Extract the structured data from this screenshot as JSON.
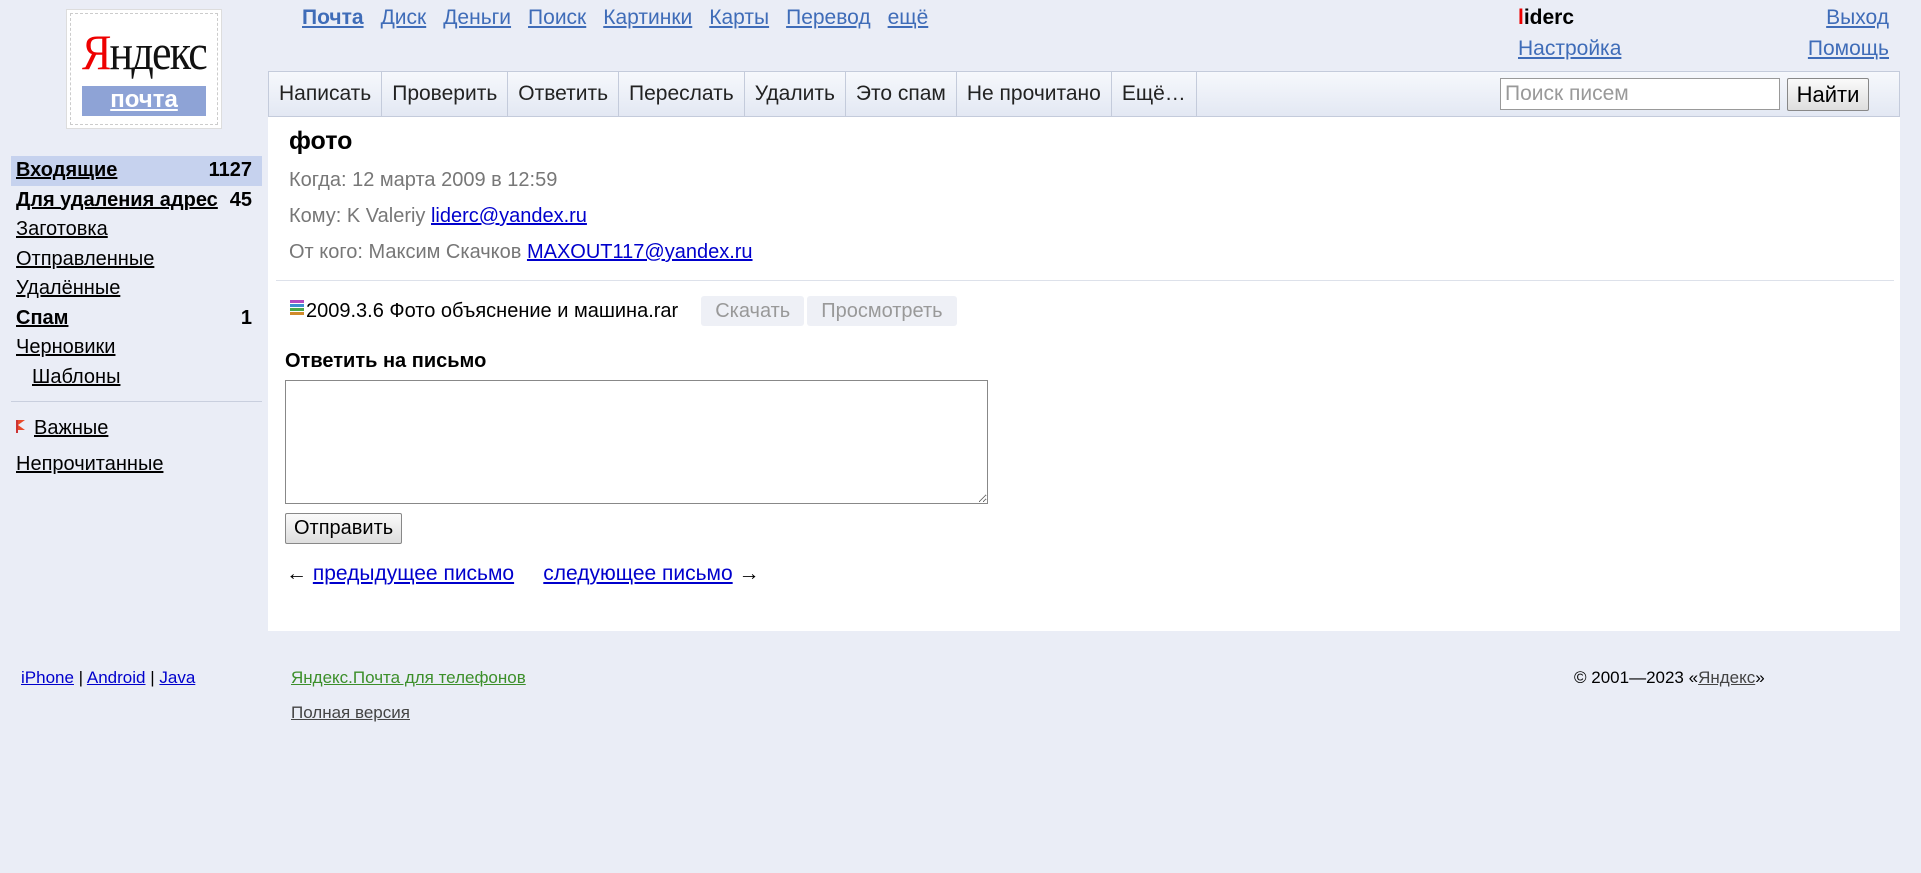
{
  "logo": {
    "word_first": "Я",
    "word_rest": "ндекс",
    "sub": "почта"
  },
  "topnav": [
    "Почта",
    "Диск",
    "Деньги",
    "Поиск",
    "Картинки",
    "Карты",
    "Перевод",
    "ещё"
  ],
  "user": {
    "first": "l",
    "rest": "iderc",
    "settings": "Настройка",
    "logout": "Выход",
    "help": "Помощь"
  },
  "toolbar": {
    "buttons": [
      "Написать",
      "Проверить",
      "Ответить",
      "Переслать",
      "Удалить",
      "Это спам",
      "Не прочитано",
      "Ещё…"
    ],
    "search_placeholder": "Поиск писем",
    "search_button": "Найти"
  },
  "folders": [
    {
      "name": "Входящие",
      "count": "1127"
    },
    {
      "name": "Для удаления адрес",
      "count": "45"
    },
    {
      "name": "Заготовка",
      "count": ""
    },
    {
      "name": "Отправленные",
      "count": ""
    },
    {
      "name": "Удалённые",
      "count": ""
    },
    {
      "name": "Спам",
      "count": "1"
    },
    {
      "name": "Черновики",
      "count": ""
    },
    {
      "name": "Шаблоны",
      "count": ""
    }
  ],
  "labels": {
    "important": "Важные",
    "unread": "Непрочитанные"
  },
  "message": {
    "subject": "фото",
    "when_label": "Когда:",
    "when": "12 марта 2009 в 12:59",
    "to_label": "Кому:",
    "to_name": "K Valeriy",
    "to_email": "liderc@yandex.ru",
    "from_label": "От кого:",
    "from_name": "Максим Скачков",
    "from_email": "MAXOUT117@yandex.ru",
    "attachment": "2009.3.6 Фото объяснение и машина.rar",
    "download": "Скачать",
    "view": "Просмотреть"
  },
  "reply": {
    "title": "Ответить на письмо",
    "send": "Отправить"
  },
  "pager": {
    "prev_arrow": "←",
    "prev": "предыдущее письмо",
    "next": "следующее письмо",
    "next_arrow": "→"
  },
  "footer": {
    "iphone": "iPhone",
    "android": "Android",
    "java": "Java",
    "sep": "|",
    "mobile": "Яндекс.Почта для телефонов",
    "full": "Полная версия",
    "copy_pre": "© 2001—2023 «",
    "copy_link": "Яндекс",
    "copy_post": "»"
  }
}
